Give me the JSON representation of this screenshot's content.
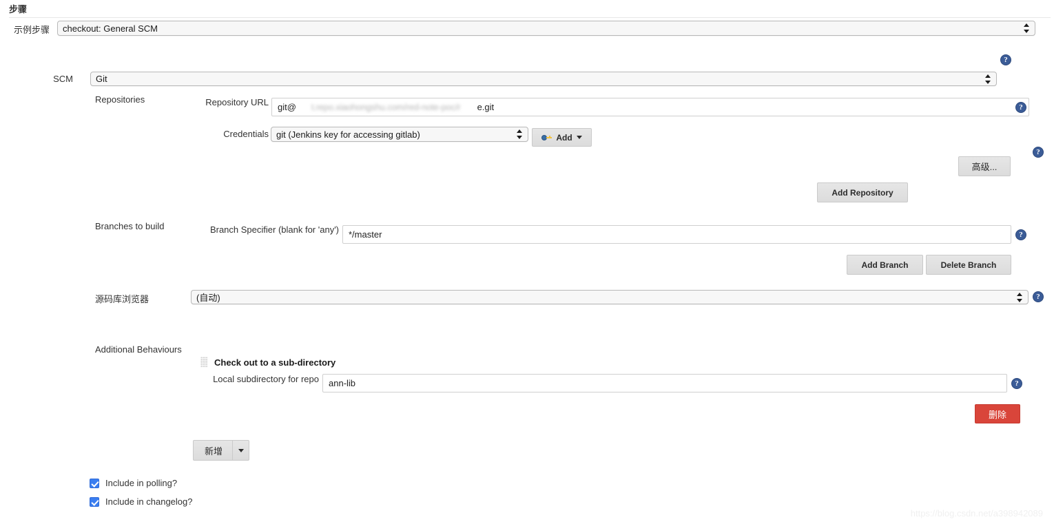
{
  "header": {
    "section_title": "步骤",
    "sample_step_label": "示例步骤",
    "sample_step_value": "checkout: General SCM"
  },
  "scm": {
    "label": "SCM",
    "value": "Git"
  },
  "repositories": {
    "label": "Repositories",
    "repository_url_label": "Repository URL",
    "repository_url_prefix": "git@",
    "repository_url_redacted": "t.repo.xiaohongshu.com/red-note-poc/r",
    "repository_url_suffix": "e.git",
    "credentials_label": "Credentials",
    "credentials_value": "git (Jenkins key for accessing gitlab)",
    "add_credentials_label": "Add",
    "advanced_label": "高级...",
    "add_repository_label": "Add Repository"
  },
  "branches": {
    "label": "Branches to build",
    "branch_specifier_label": "Branch Specifier (blank for 'any')",
    "branch_specifier_value": "*/master",
    "add_branch_label": "Add Branch",
    "delete_branch_label": "Delete Branch"
  },
  "browser": {
    "label": "源码库浏览器",
    "value": "(自动)"
  },
  "behaviours": {
    "label": "Additional Behaviours",
    "item_title": "Check out to a sub-directory",
    "subdir_label": "Local subdirectory for repo",
    "subdir_value": "ann-lib",
    "delete_label": "删除",
    "add_label": "新增"
  },
  "options": {
    "include_in_polling": "Include in polling?",
    "include_in_changelog": "Include in changelog?"
  },
  "help_icon_glyph": "?",
  "watermark": "https://blog.csdn.net/a398942089",
  "colors": {
    "accent_blue": "#3b5c97",
    "checkbox_blue": "#3b7ef0",
    "danger_red": "#d9453a"
  }
}
